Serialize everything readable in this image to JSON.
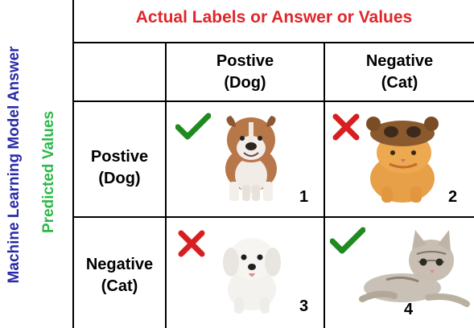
{
  "side_labels": {
    "outer": "Machine Learning Model Answer",
    "inner": "Predicted Values"
  },
  "header": {
    "title": "Actual Labels or Answer or Values",
    "col_positive": [
      "Postive",
      "(Dog)"
    ],
    "col_negative": [
      "Negative",
      "(Cat)"
    ]
  },
  "rows": {
    "positive": [
      "Postive",
      "(Dog)"
    ],
    "negative": [
      "Negative",
      "(Cat)"
    ]
  },
  "cells": [
    {
      "number": "1",
      "mark": "check-icon",
      "animal": "bulldog"
    },
    {
      "number": "2",
      "mark": "cross-icon",
      "animal": "orange-cat-in-hat"
    },
    {
      "number": "3",
      "mark": "cross-icon",
      "animal": "white-puppy"
    },
    {
      "number": "4",
      "mark": "check-icon",
      "animal": "tabby-kitten"
    }
  ],
  "colors": {
    "outer_label": "#2a2aa8",
    "inner_label": "#2db84a",
    "title": "#e0262b",
    "check": "#1f8a1f",
    "cross": "#d81e1e"
  }
}
